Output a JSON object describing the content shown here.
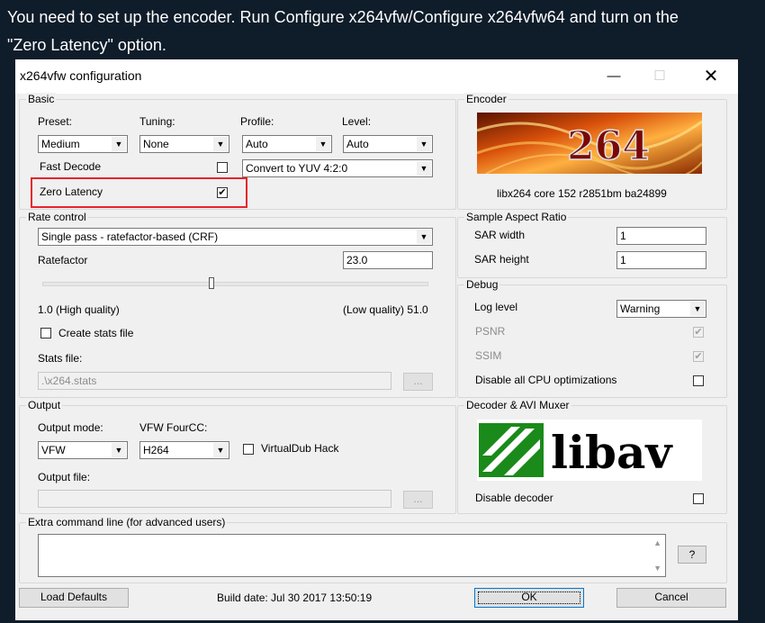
{
  "caption": {
    "line1": "You need to set up the encoder. Run Configure x264vfw/Configure x264vfw64 and turn on the",
    "line2": "\"Zero Latency\" option."
  },
  "window": {
    "title": "x264vfw configuration",
    "minimize_glyph": "—",
    "maximize_glyph": "☐",
    "close_glyph": "✕"
  },
  "basic": {
    "group_label": "Basic",
    "preset_label": "Preset:",
    "preset_value": "Medium",
    "tuning_label": "Tuning:",
    "tuning_value": "None",
    "profile_label": "Profile:",
    "profile_value": "Auto",
    "level_label": "Level:",
    "level_value": "Auto",
    "fast_decode_label": "Fast Decode",
    "colorspace_value": "Convert to YUV 4:2:0",
    "zero_latency_label": "Zero Latency",
    "zero_latency_checked": true
  },
  "encoder": {
    "group_label": "Encoder",
    "logo_text": "264",
    "version": "libx264 core 152 r2851bm ba24899"
  },
  "rate_control": {
    "group_label": "Rate control",
    "mode_value": "Single pass - ratefactor-based (CRF)",
    "ratefactor_label": "Ratefactor",
    "ratefactor_value": "23.0",
    "ratefactor_min": 1.0,
    "ratefactor_max": 51.0,
    "ratefactor_current": 23.0,
    "high_quality_label": "1.0 (High quality)",
    "low_quality_label": "(Low quality) 51.0",
    "create_stats_label": "Create stats file",
    "stats_file_label": "Stats file:",
    "stats_file_value": ".\\x264.stats",
    "browse_label": "..."
  },
  "sar": {
    "group_label": "Sample Aspect Ratio",
    "width_label": "SAR width",
    "width_value": "1",
    "height_label": "SAR height",
    "height_value": "1"
  },
  "debug": {
    "group_label": "Debug",
    "log_level_label": "Log level",
    "log_level_value": "Warning",
    "psnr_label": "PSNR",
    "ssim_label": "SSIM",
    "disable_cpu_label": "Disable all CPU optimizations"
  },
  "output": {
    "group_label": "Output",
    "mode_label": "Output mode:",
    "mode_value": "VFW",
    "fourcc_label": "VFW FourCC:",
    "fourcc_value": "H264",
    "virtualdub_label": "VirtualDub Hack",
    "file_label": "Output file:",
    "browse_label": "..."
  },
  "decoder": {
    "group_label": "Decoder & AVI Muxer",
    "logo_text": "libav",
    "disable_label": "Disable decoder"
  },
  "extra": {
    "group_label": "Extra command line (for advanced users)",
    "help_label": "?"
  },
  "footer": {
    "load_defaults_label": "Load Defaults",
    "build_date": "Build date: Jul 30 2017 13:50:19",
    "ok_label": "OK",
    "cancel_label": "Cancel"
  },
  "colors": {
    "highlight": "#e8232d",
    "page_background": "#0f1c2a",
    "libav_green": "#1a8a1a"
  }
}
